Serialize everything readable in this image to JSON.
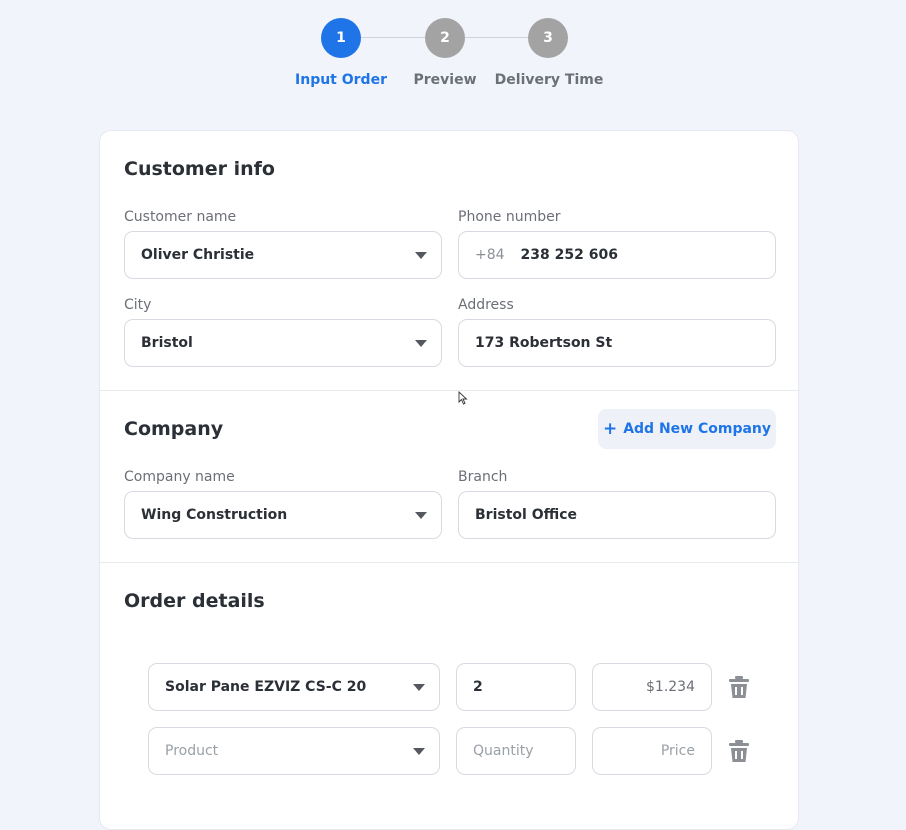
{
  "stepper": {
    "steps": [
      {
        "number": "1",
        "label": "Input Order",
        "active": true
      },
      {
        "number": "2",
        "label": "Preview",
        "active": false
      },
      {
        "number": "3",
        "label": "Delivery Time",
        "active": false
      }
    ]
  },
  "customer": {
    "title": "Customer info",
    "name_label": "Customer name",
    "name_value": "Oliver Christie",
    "phone_label": "Phone number",
    "phone_prefix": "+84",
    "phone_value": "238 252 606",
    "city_label": "City",
    "city_value": "Bristol",
    "address_label": "Address",
    "address_value": "173 Robertson St"
  },
  "company": {
    "title": "Company",
    "add_button": "Add New Company",
    "add_icon": "+",
    "name_label": "Company name",
    "name_value": "Wing Construction",
    "branch_label": "Branch",
    "branch_value": "Bristol Office"
  },
  "order": {
    "title": "Order details",
    "items": [
      {
        "product": "Solar Pane EZVIZ CS-C 20",
        "quantity": "2",
        "price": "$1.234"
      }
    ],
    "new_row": {
      "product_placeholder": "Product",
      "quantity_placeholder": "Quantity",
      "price_placeholder": "Price"
    }
  },
  "colors": {
    "accent": "#1f74e8",
    "inactive_step": "#a3a3a3",
    "background": "#f1f5fb"
  },
  "icons": {
    "dropdown": "caret-down-icon",
    "delete": "trash-icon",
    "add": "plus-icon"
  }
}
